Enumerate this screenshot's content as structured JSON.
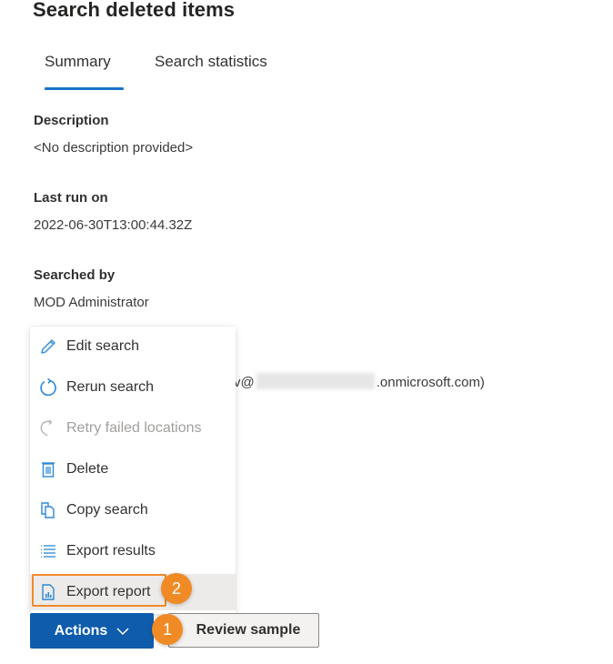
{
  "page": {
    "title": "Search deleted items"
  },
  "tabs": [
    {
      "label": "Summary",
      "selected": true
    },
    {
      "label": "Search statistics",
      "selected": false
    }
  ],
  "fields": {
    "description": {
      "label": "Description",
      "value": "<No description provided>"
    },
    "last_run": {
      "label": "Last run on",
      "value": "2022-06-30T13:00:44.32Z"
    },
    "searched_by": {
      "label": "Searched by",
      "value": "MOD Administrator"
    }
  },
  "email": {
    "prefix": "v@",
    "suffix": ".onmicrosoft.com)"
  },
  "actions_menu": {
    "items": [
      {
        "label": "Edit search",
        "icon": "pencil-icon",
        "disabled": false
      },
      {
        "label": "Rerun search",
        "icon": "refresh-icon",
        "disabled": false
      },
      {
        "label": "Retry failed locations",
        "icon": "retry-icon",
        "disabled": true
      },
      {
        "label": "Delete",
        "icon": "trash-icon",
        "disabled": false
      },
      {
        "label": "Copy search",
        "icon": "copy-icon",
        "disabled": false
      },
      {
        "label": "Export results",
        "icon": "list-icon",
        "disabled": false
      },
      {
        "label": "Export report",
        "icon": "report-icon",
        "disabled": false,
        "hovered": true
      }
    ]
  },
  "buttons": {
    "actions_label": "Actions",
    "review_sample_label": "Review sample"
  },
  "callouts": {
    "step1": "1",
    "step2": "2"
  },
  "colors": {
    "primary": "#0f5cad",
    "tab_underline": "#1a73c8",
    "icon_blue": "#2b88d8",
    "callout_orange": "#f08a24"
  }
}
